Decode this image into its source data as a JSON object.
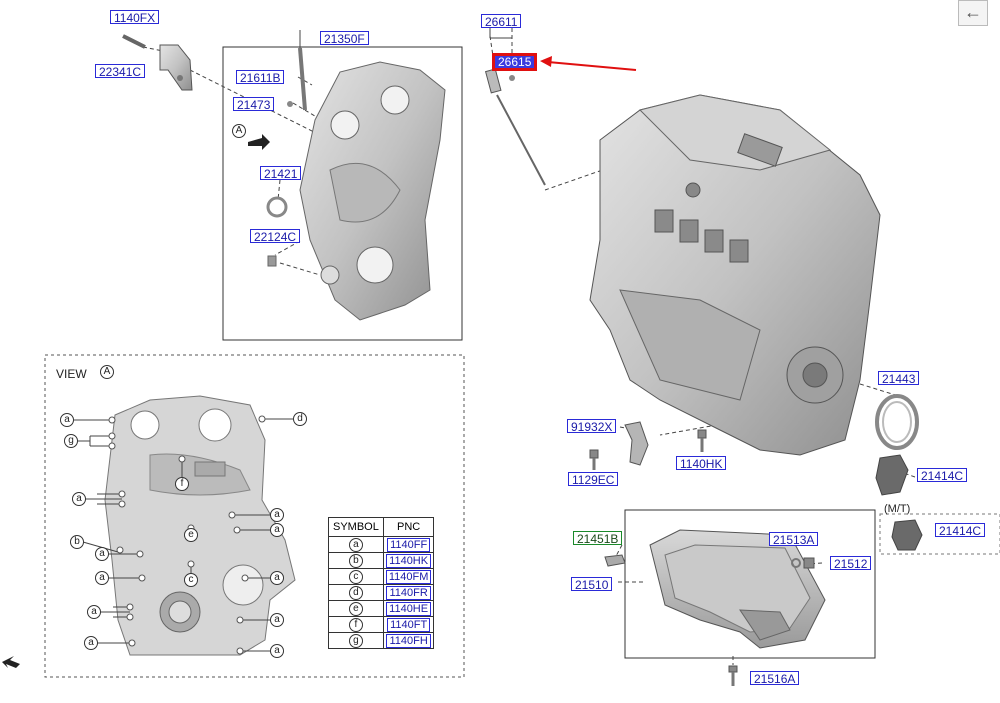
{
  "nav": {
    "back_glyph": "←"
  },
  "labels": {
    "p1140FX": "1140FX",
    "p22341C": "22341C",
    "p21350F": "21350F",
    "p21611B": "21611B",
    "p21473": "21473",
    "p21421": "21421",
    "p22124C": "22124C",
    "p26611": "26611",
    "p26615": "26615",
    "p21443": "21443",
    "p91932X": "91932X",
    "p1129EC": "1129EC",
    "p1140HK": "1140HK",
    "p21414C_a": "21414C",
    "p21414C_b": "21414C",
    "p21451B": "21451B",
    "p21513A": "21513A",
    "p21512": "21512",
    "p21510": "21510",
    "p21516A": "21516A"
  },
  "view": {
    "title": "VIEW",
    "marker": "A",
    "mt_note": "(M/T)"
  },
  "symbols": [
    "a",
    "b",
    "c",
    "d",
    "e",
    "f",
    "g"
  ],
  "table": {
    "headers": {
      "symbol": "SYMBOL",
      "pnc": "PNC"
    },
    "rows": [
      {
        "symbol": "a",
        "pnc": "1140FF"
      },
      {
        "symbol": "b",
        "pnc": "1140HK"
      },
      {
        "symbol": "c",
        "pnc": "1140FM"
      },
      {
        "symbol": "d",
        "pnc": "1140FR"
      },
      {
        "symbol": "e",
        "pnc": "1140HE"
      },
      {
        "symbol": "f",
        "pnc": "1140FT"
      },
      {
        "symbol": "g",
        "pnc": "1140FH"
      }
    ]
  },
  "colors": {
    "highlight": "#e01010",
    "label_border": "#2a2ad8",
    "green_label": "#1a8a2a"
  }
}
